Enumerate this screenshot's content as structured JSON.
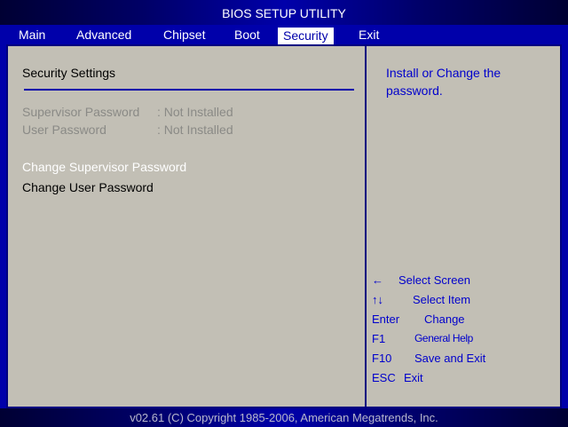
{
  "title": "BIOS SETUP UTILITY",
  "tabs": [
    {
      "label": "Main"
    },
    {
      "label": "Advanced"
    },
    {
      "label": "Chipset"
    },
    {
      "label": "Boot"
    },
    {
      "label": "Security"
    },
    {
      "label": "Exit"
    }
  ],
  "active_tab": "Security",
  "section": {
    "heading": "Security Settings",
    "supervisor_password_label": "Supervisor Password",
    "supervisor_password_value": ": Not Installed",
    "user_password_label": "User Password",
    "user_password_value": ": Not Installed",
    "change_supervisor": "Change Supervisor Password",
    "change_user": "Change User Password"
  },
  "help": {
    "line1": "Install or Change the",
    "line2": "password."
  },
  "keys": [
    {
      "key": "←",
      "desc": "Select Screen"
    },
    {
      "key": "↑↓",
      "desc": "Select Item"
    },
    {
      "key": "Enter",
      "desc": "Change"
    },
    {
      "key": "F1",
      "desc": "General Help"
    },
    {
      "key": "F10",
      "desc": "Save and Exit"
    },
    {
      "key": "ESC",
      "desc": "Exit"
    }
  ],
  "footer": "v02.61 (C) Copyright 1985-2006, American Megatrends, Inc.",
  "colors": {
    "background": "#0000aa",
    "panel": "#c2bfb5",
    "highlight_text": "#ffffff",
    "help_text": "#0000cc",
    "disabled_text": "#8a8a86"
  }
}
